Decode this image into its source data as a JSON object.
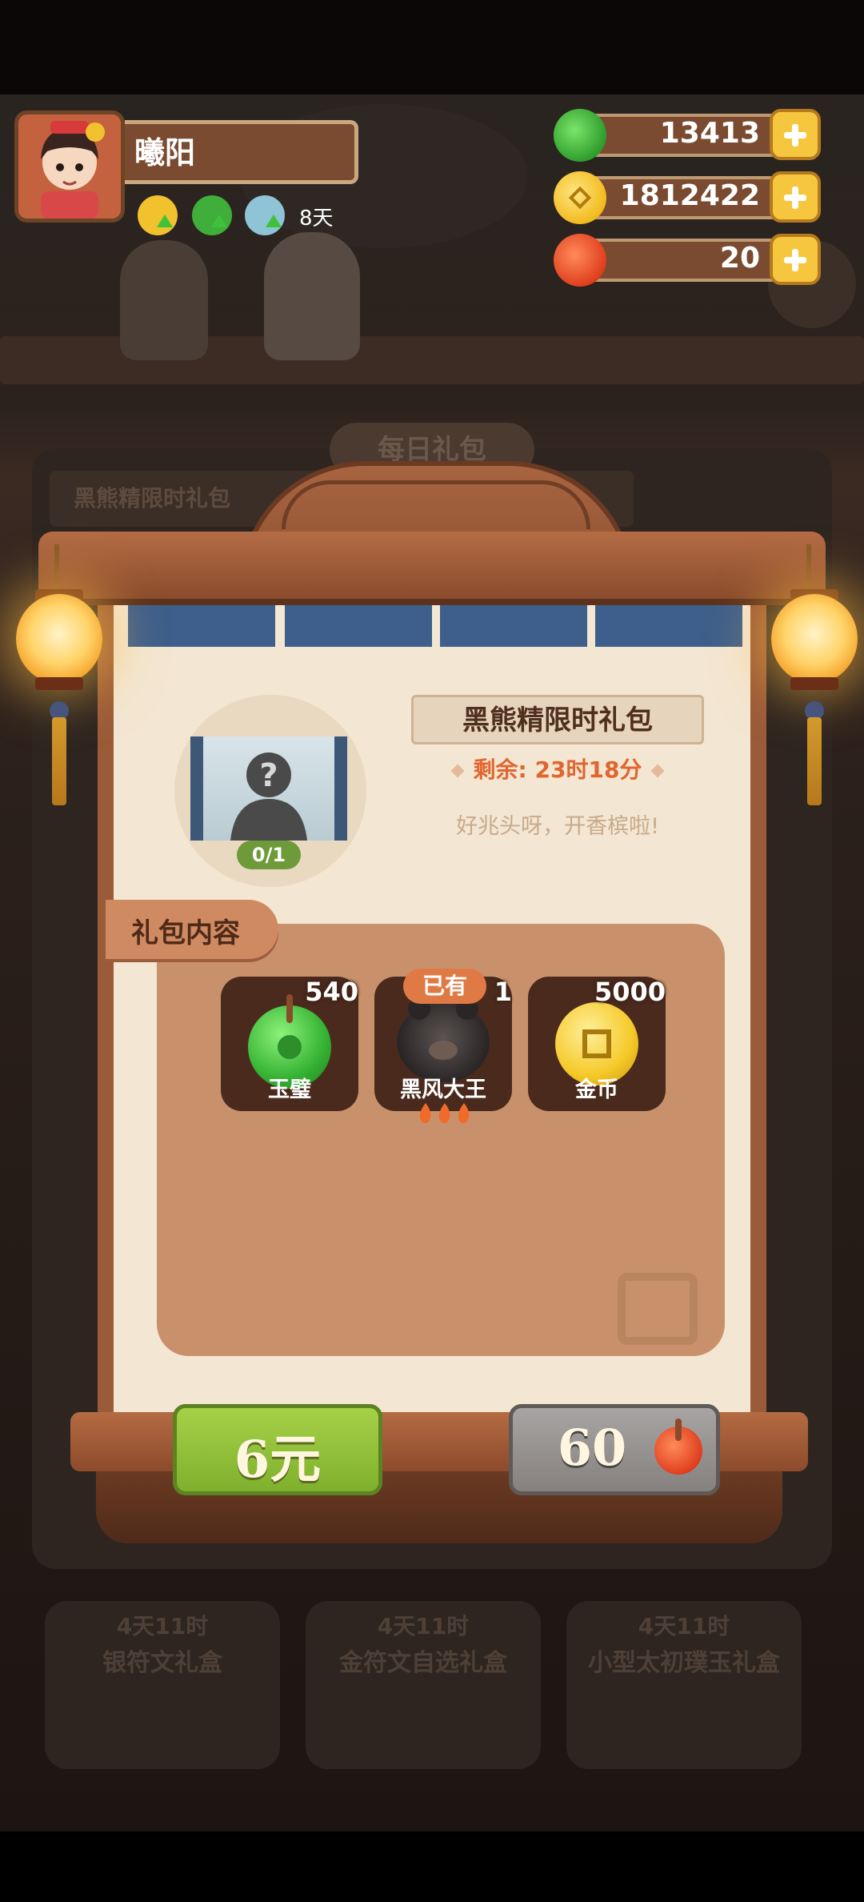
{
  "player": {
    "name": "曦阳",
    "days": "8天"
  },
  "resources": [
    {
      "icon": "jade-icon",
      "value": "13413"
    },
    {
      "icon": "coin-icon",
      "value": "1812422"
    },
    {
      "icon": "red-gem-icon",
      "value": "20"
    }
  ],
  "background": {
    "tab_title": "每日礼包",
    "banner": "黑熊精限时礼包",
    "cards": [
      {
        "timer": "4天11时",
        "name": "银符文礼盒"
      },
      {
        "timer": "4天11时",
        "name": "金符文自选礼盒"
      },
      {
        "timer": "4天11时",
        "name": "小型太初璞玉礼盒"
      }
    ]
  },
  "modal": {
    "title": "黑熊精限时礼包",
    "remaining": "剩余: 23时18分",
    "slogan": "好兆头呀，开香槟啦!",
    "fragment_progress": "0/1",
    "content_tab": "礼包内容",
    "items": [
      {
        "label": "玉璧",
        "count": "540",
        "icon": "jade-disc-icon"
      },
      {
        "label": "黑风大王",
        "count": "1",
        "icon": "black-bear-icon",
        "badge": "已有"
      },
      {
        "label": "金币",
        "count": "5000",
        "icon": "gold-coin-icon"
      }
    ],
    "buy_price": "6元",
    "gem_price": "60"
  }
}
